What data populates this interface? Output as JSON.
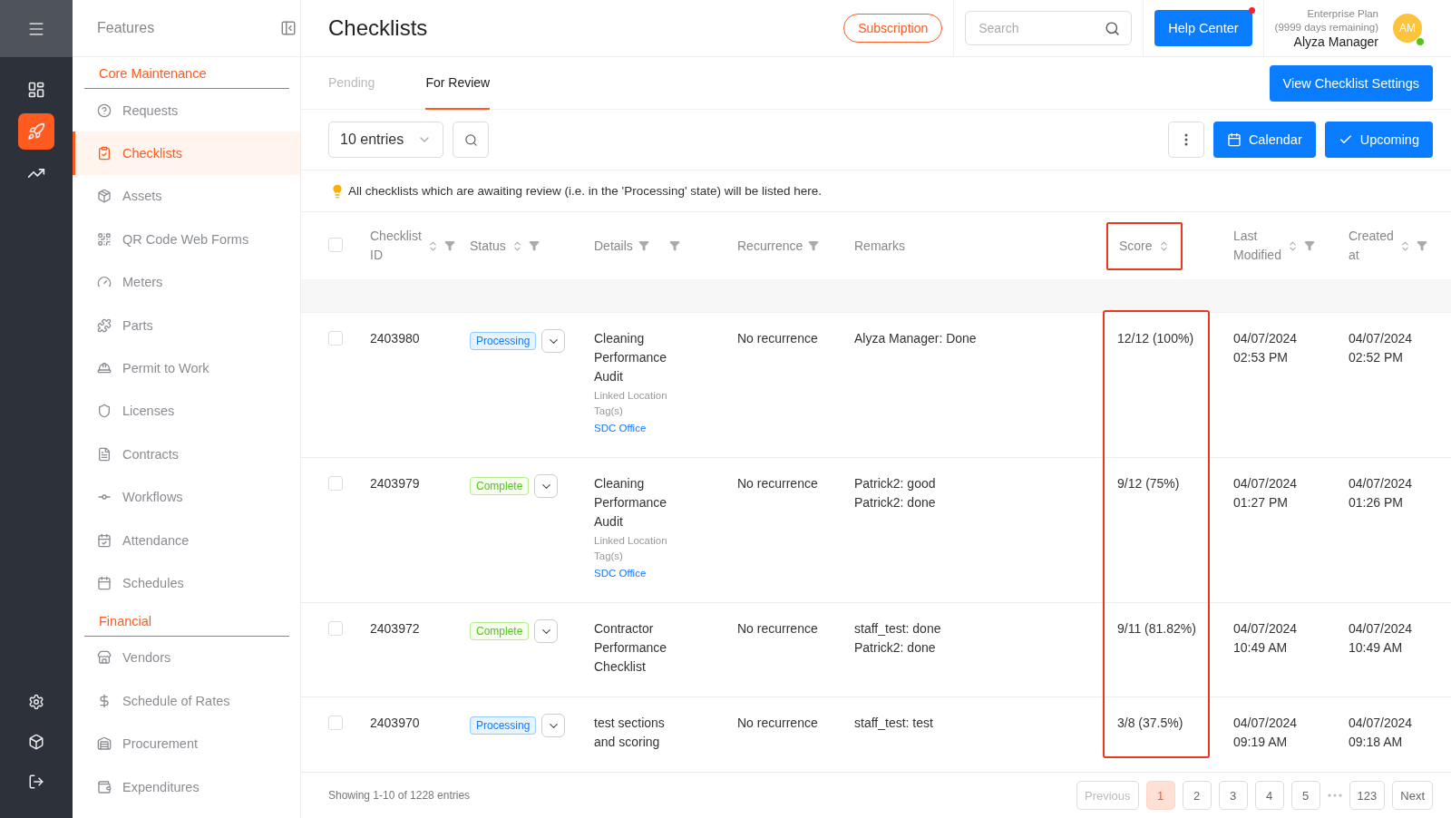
{
  "rail": {
    "top": [
      {
        "selected": false
      },
      {
        "selected": true
      },
      {
        "selected": false
      }
    ],
    "bottom": [
      {
        "selected": false
      },
      {
        "selected": false
      },
      {
        "selected": false
      }
    ]
  },
  "sidebar": {
    "title": "Features",
    "sections": [
      {
        "title": "Core Maintenance",
        "items": [
          {
            "label": "Requests",
            "selected": false
          },
          {
            "label": "Checklists",
            "selected": true
          },
          {
            "label": "Assets",
            "selected": false
          },
          {
            "label": "QR Code Web Forms",
            "selected": false
          },
          {
            "label": "Meters",
            "selected": false
          },
          {
            "label": "Parts",
            "selected": false
          },
          {
            "label": "Permit to Work",
            "selected": false
          },
          {
            "label": "Licenses",
            "selected": false
          },
          {
            "label": "Contracts",
            "selected": false
          },
          {
            "label": "Workflows",
            "selected": false
          },
          {
            "label": "Attendance",
            "selected": false
          },
          {
            "label": "Schedules",
            "selected": false
          }
        ]
      },
      {
        "title": "Financial",
        "items": [
          {
            "label": "Vendors",
            "selected": false
          },
          {
            "label": "Schedule of Rates",
            "selected": false
          },
          {
            "label": "Procurement",
            "selected": false
          },
          {
            "label": "Expenditures",
            "selected": false
          }
        ]
      }
    ]
  },
  "header": {
    "title": "Checklists",
    "subscription": "Subscription",
    "search": {
      "placeholder": "Search"
    },
    "help": {
      "label": "Help Center",
      "notification": true
    },
    "plan": "Enterprise Plan",
    "days": "(9999 days remaining)",
    "user": "Alyza Manager",
    "avatar": {
      "initials": "AM",
      "online": true
    }
  },
  "tabs": [
    {
      "label": "Pending",
      "selected": false
    },
    {
      "label": "For Review",
      "selected": true
    }
  ],
  "settings_button": "View Checklist Settings",
  "toolbar": {
    "entries": "10 entries",
    "calendar": "Calendar",
    "upcoming": "Upcoming"
  },
  "notice": "All checklists which are awaiting review (i.e. in the 'Processing' state) will be listed here.",
  "table": {
    "select_all": {
      "checked": false
    },
    "columns": [
      {
        "label": "Checklist ID",
        "sortable": true,
        "filterable": true,
        "extra_filter": false,
        "highlighted": false
      },
      {
        "label": "Status",
        "sortable": true,
        "filterable": true,
        "extra_filter": false,
        "highlighted": false
      },
      {
        "label": "Details",
        "sortable": false,
        "filterable": true,
        "extra_filter": true,
        "highlighted": false
      },
      {
        "label": "Recurrence",
        "sortable": false,
        "filterable": true,
        "extra_filter": false,
        "highlighted": false
      },
      {
        "label": "Remarks",
        "sortable": false,
        "filterable": false,
        "extra_filter": false,
        "highlighted": false
      },
      {
        "label": "Score",
        "sortable": true,
        "filterable": false,
        "extra_filter": false,
        "highlighted": true
      },
      {
        "label": "Last Modified",
        "sortable": true,
        "filterable": true,
        "extra_filter": false,
        "highlighted": false
      },
      {
        "label": "Created at",
        "sortable": true,
        "filterable": true,
        "extra_filter": false,
        "highlighted": false
      }
    ],
    "rows": [
      {
        "checked": false,
        "id": "2403980",
        "status": {
          "kind": "processing",
          "label": "Processing"
        },
        "details": "Cleaning Performance Audit",
        "location_label": "Linked Location Tag(s)",
        "location": "SDC Office",
        "recurrence": "No recurrence",
        "remarks": [
          "Alyza Manager: Done"
        ],
        "score": "12/12 (100%)",
        "modified": "04/07/2024 02:53 PM",
        "created": "04/07/2024 02:52 PM"
      },
      {
        "checked": false,
        "id": "2403979",
        "status": {
          "kind": "complete",
          "label": "Complete"
        },
        "details": "Cleaning Performance Audit",
        "location_label": "Linked Location Tag(s)",
        "location": "SDC Office",
        "recurrence": "No recurrence",
        "remarks": [
          "Patrick2: good",
          "Patrick2: done"
        ],
        "score": "9/12 (75%)",
        "modified": "04/07/2024 01:27 PM",
        "created": "04/07/2024 01:26 PM"
      },
      {
        "checked": false,
        "id": "2403972",
        "status": {
          "kind": "complete",
          "label": "Complete"
        },
        "details": "Contractor Performance Checklist",
        "recurrence": "No recurrence",
        "remarks": [
          "staff_test: done",
          "Patrick2: done"
        ],
        "score": "9/11 (81.82%)",
        "modified": "04/07/2024 10:49 AM",
        "created": "04/07/2024 10:49 AM"
      },
      {
        "checked": false,
        "id": "2403970",
        "status": {
          "kind": "processing",
          "label": "Processing"
        },
        "details": "test sections and scoring",
        "recurrence": "No recurrence",
        "remarks": [
          "staff_test: test"
        ],
        "score": "3/8 (37.5%)",
        "modified": "04/07/2024 09:19 AM",
        "created": "04/07/2024 09:18 AM"
      }
    ]
  },
  "footer": {
    "showing": "Showing 1-10 of 1228 entries",
    "previous": "Previous",
    "pages": [
      {
        "label": "1",
        "selected": true
      },
      {
        "label": "2",
        "selected": false
      },
      {
        "label": "3",
        "selected": false
      },
      {
        "label": "4",
        "selected": false
      },
      {
        "label": "5",
        "selected": false
      },
      {
        "label": "123",
        "selected": false
      }
    ],
    "next": "Next"
  }
}
